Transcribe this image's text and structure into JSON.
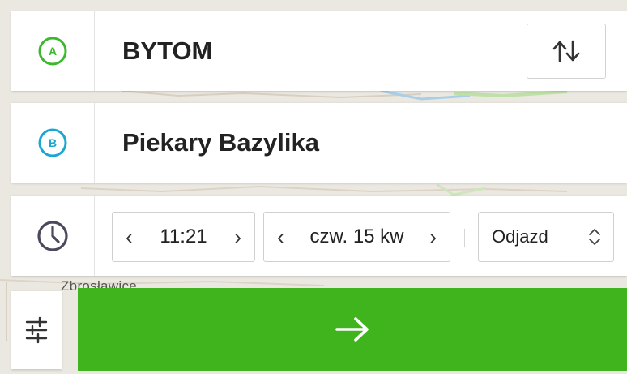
{
  "origin": {
    "value": "BYTOM",
    "badge": "A",
    "color": "#3db82d"
  },
  "destination": {
    "value": "Piekary Bazylika",
    "badge": "B",
    "color": "#1aa6d1"
  },
  "time": {
    "hours": "11",
    "minutes": "21",
    "separator": ":"
  },
  "date": {
    "value": "czw. 15 kw"
  },
  "mode": {
    "selected": "Odjazd"
  },
  "map": {
    "label": "Zbrosławice"
  },
  "icons": {
    "origin": "circle-a-icon",
    "destination": "circle-b-icon",
    "swap": "swap-vertical-icon",
    "clock": "clock-icon",
    "filter": "sliders-icon",
    "search": "arrow-right-icon",
    "select": "chevron-up-down-icon"
  },
  "colors": {
    "go_button": "#40b41c",
    "accent_dark": "#4a4a5e"
  }
}
